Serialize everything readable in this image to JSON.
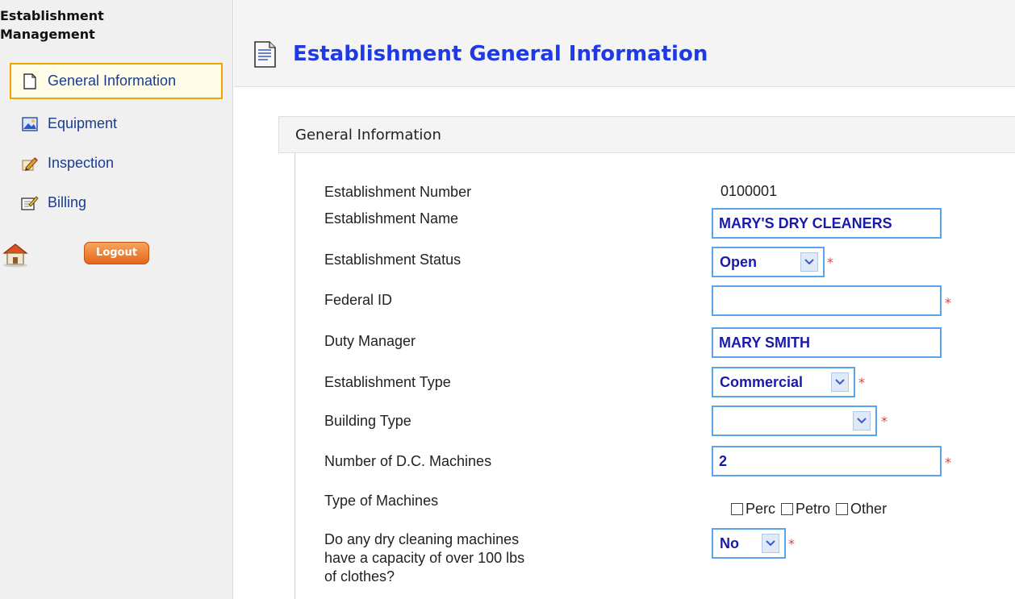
{
  "sidebar": {
    "title": "Establishment Management",
    "items": [
      {
        "label": "General Information",
        "icon": "page-icon",
        "active": true
      },
      {
        "label": "Equipment",
        "icon": "image-icon"
      },
      {
        "label": "Inspection",
        "icon": "pencil-icon"
      },
      {
        "label": "Billing",
        "icon": "edit-icon"
      }
    ],
    "logout_label": "Logout"
  },
  "page": {
    "title": "Establishment General Information"
  },
  "section": {
    "title": "General Information"
  },
  "form": {
    "establishment_number": {
      "label": "Establishment Number",
      "value": "0100001"
    },
    "establishment_name": {
      "label": "Establishment Name",
      "value": "MARY'S DRY CLEANERS"
    },
    "establishment_status": {
      "label": "Establishment Status",
      "value": "Open",
      "required": true
    },
    "federal_id": {
      "label": "Federal ID",
      "value": "",
      "required": true
    },
    "duty_manager": {
      "label": "Duty Manager",
      "value": "MARY SMITH"
    },
    "establishment_type": {
      "label": "Establishment Type",
      "value": "Commercial",
      "required": true
    },
    "building_type": {
      "label": "Building Type",
      "value": "",
      "required": true
    },
    "dc_machines": {
      "label": "Number of D.C. Machines",
      "value": "2",
      "required": true
    },
    "machine_types": {
      "label": "Type of Machines",
      "options": [
        {
          "label": "Perc",
          "checked": false
        },
        {
          "label": "Petro",
          "checked": false
        },
        {
          "label": "Other",
          "checked": false
        }
      ]
    },
    "capacity": {
      "label_line1": "Do any dry cleaning machines",
      "label_line2": "have a capacity of over 100 lbs",
      "label_line3": "of clothes?",
      "value": "No",
      "required": true
    }
  },
  "colors": {
    "title_blue": "#1e3ae6",
    "nav_blue": "#1a3c8e",
    "input_border": "#5aa3e8",
    "input_text": "#1a1aa8",
    "active_border": "#f0a400",
    "logout_orange": "#e4661a",
    "required_red": "#d64545"
  },
  "required_marker": "*"
}
